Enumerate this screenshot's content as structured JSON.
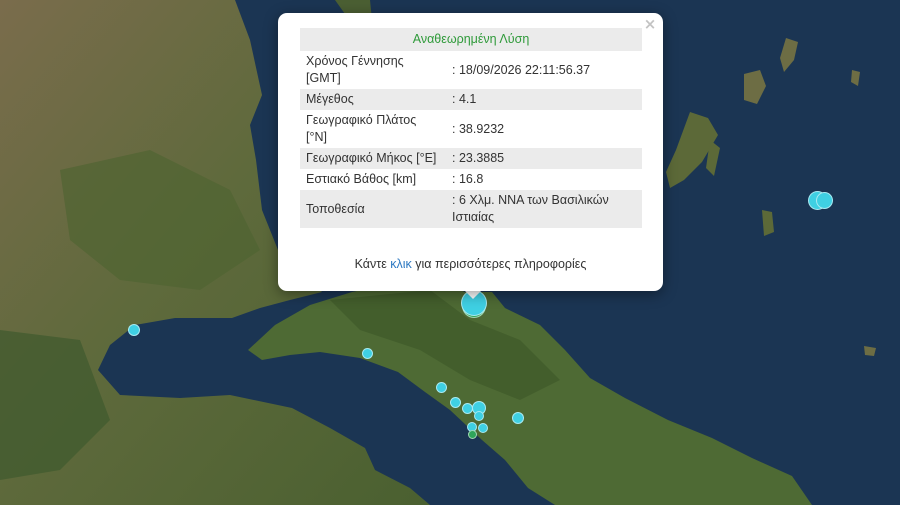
{
  "popup": {
    "close_symbol": "×",
    "header": "Αναθεωρημένη Λύση",
    "rows": [
      {
        "label": "Χρόνος Γέννησης [GMT]",
        "value": ": 18/09/2026 22:11:56.37"
      },
      {
        "label": "Μέγεθος",
        "value": ": 4.1"
      },
      {
        "label": "Γεωγραφικό Πλάτος [°N]",
        "value": ": 38.9232"
      },
      {
        "label": "Γεωγραφικό Μήκος [°E]",
        "value": ": 23.3885"
      },
      {
        "label": "Εστιακό Βάθος [km]",
        "value": ": 16.8"
      },
      {
        "label": "Τοποθεσία",
        "value": ": 6 Χλμ. ΝΝΑ των Βασιλικών Ιστιαίας"
      }
    ],
    "more_prefix": "Κάντε",
    "more_link": "κλικ",
    "more_suffix": "για περισσότερες πληροφορίες"
  },
  "colors": {
    "sea": "#1a3452",
    "land": "#5b6b3a",
    "quake_recent": "#3fd0e3",
    "quake_older": "#2fa55a",
    "header_text": "#2f9a3a",
    "link": "#2e79c2"
  }
}
